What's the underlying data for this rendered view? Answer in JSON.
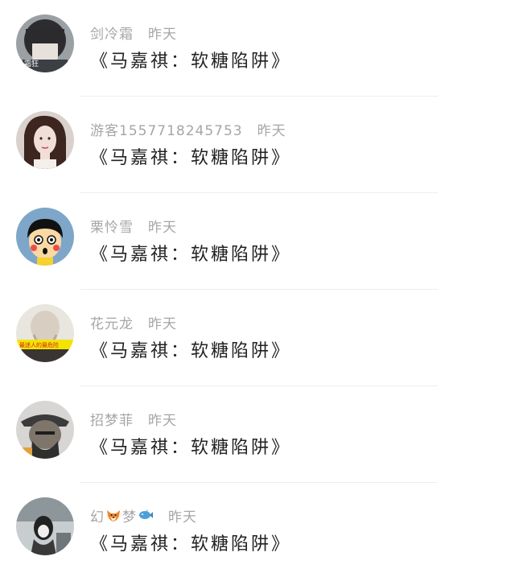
{
  "comments": [
    {
      "username": "剑冷霜",
      "time": "昨天",
      "message": "《马嘉祺：软糖陷阱》",
      "avatar": "avatar-user-1"
    },
    {
      "username": "游客1557718245753",
      "time": "昨天",
      "message": "《马嘉祺：软糖陷阱》",
      "avatar": "avatar-user-2"
    },
    {
      "username": "栗怜雪",
      "time": "昨天",
      "message": "《马嘉祺：软糖陷阱》",
      "avatar": "avatar-user-3"
    },
    {
      "username": "花元龙",
      "time": "昨天",
      "message": "《马嘉祺：软糖陷阱》",
      "avatar": "avatar-user-4"
    },
    {
      "username": "招梦菲",
      "time": "昨天",
      "message": "《马嘉祺：软糖陷阱》",
      "avatar": "avatar-user-5"
    },
    {
      "username": "幻",
      "username_mid": "梦",
      "time": "昨天",
      "message": "《马嘉祺：软糖陷阱》",
      "avatar": "avatar-user-6",
      "emoji": [
        "fox-emoji-icon",
        "fish-emoji-icon"
      ]
    }
  ],
  "avatar_texts": {
    "avatar1_label": "霜狂",
    "avatar4_label": "最迷人的最危险"
  }
}
